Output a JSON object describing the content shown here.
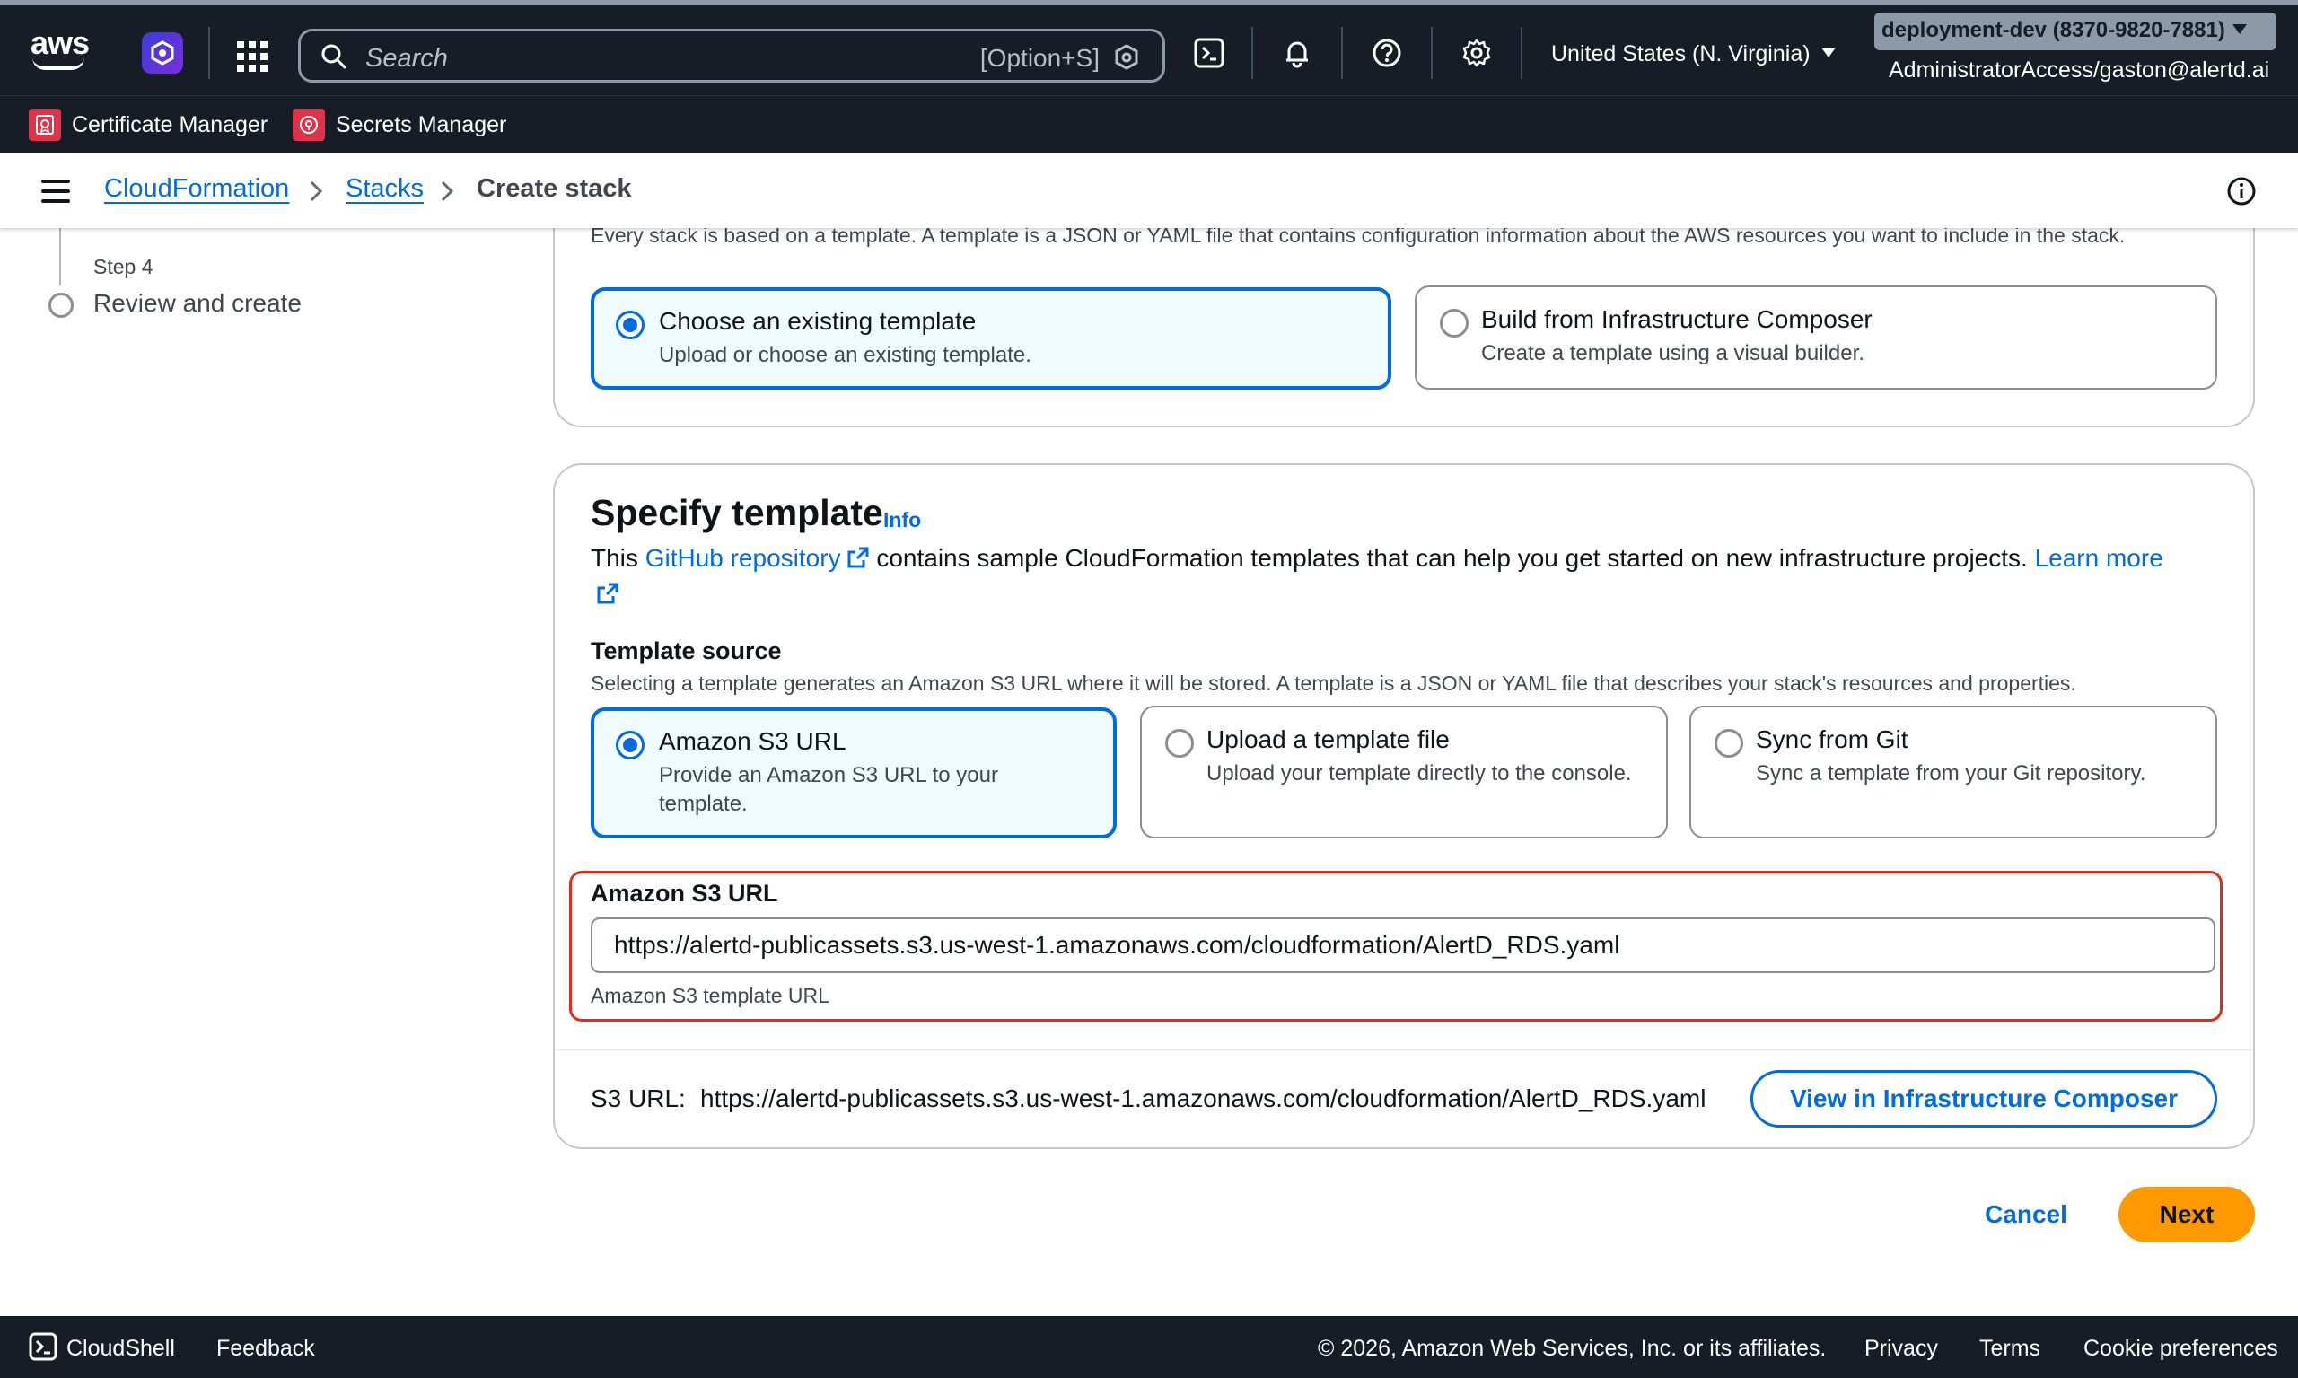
{
  "topnav": {
    "logo_text": "aws",
    "search_placeholder": "Search",
    "search_shortcut": "[Option+S]",
    "region": "United States (N. Virginia)",
    "account": "deployment-dev (8370-9820-7881)",
    "role": "AdministratorAccess/gaston@alertd.ai"
  },
  "favorites": [
    {
      "label": "Certificate Manager",
      "icon": "certificate-manager-icon"
    },
    {
      "label": "Secrets Manager",
      "icon": "secrets-manager-icon"
    }
  ],
  "breadcrumb": {
    "items": [
      "CloudFormation",
      "Stacks"
    ],
    "current": "Create stack"
  },
  "wizard": {
    "step_label": "Step 4",
    "step_title": "Review and create"
  },
  "prerequisite": {
    "description": "Every stack is based on a template. A template is a JSON or YAML file that contains configuration information about the AWS resources you want to include in the stack.",
    "options": [
      {
        "title": "Choose an existing template",
        "desc": "Upload or choose an existing template.",
        "selected": true
      },
      {
        "title": "Build from Infrastructure Composer",
        "desc": "Create a template using a visual builder.",
        "selected": false
      }
    ]
  },
  "specify": {
    "header": "Specify template",
    "info": "Info",
    "intro_pre": "This ",
    "intro_link": "GitHub repository",
    "intro_mid": " contains sample CloudFormation templates that can help you get started on new infrastructure projects. ",
    "learn_more": "Learn more",
    "source_label": "Template source",
    "source_desc": "Selecting a template generates an Amazon S3 URL where it will be stored. A template is a JSON or YAML file that describes your stack's resources and properties.",
    "sources": [
      {
        "title": "Amazon S3 URL",
        "desc": "Provide an Amazon S3 URL to your template.",
        "selected": true
      },
      {
        "title": "Upload a template file",
        "desc": "Upload your template directly to the console.",
        "selected": false
      },
      {
        "title": "Sync from Git",
        "desc": "Sync a template from your Git repository.",
        "selected": false
      }
    ],
    "url_label": "Amazon S3 URL",
    "url_value": "https://alertd-publicassets.s3.us-west-1.amazonaws.com/cloudformation/AlertD_RDS.yaml",
    "url_hint": "Amazon S3 template URL",
    "s3_label": "S3 URL:",
    "s3_value": "https://alertd-publicassets.s3.us-west-1.amazonaws.com/cloudformation/AlertD_RDS.yaml",
    "view_button": "View in Infrastructure Composer"
  },
  "actions": {
    "cancel": "Cancel",
    "next": "Next"
  },
  "footer": {
    "cloudshell": "CloudShell",
    "feedback": "Feedback",
    "copyright": "© 2026, Amazon Web Services, Inc. or its affiliates.",
    "privacy": "Privacy",
    "terms": "Terms",
    "cookies": "Cookie preferences"
  },
  "colors": {
    "accent": "#006ce0",
    "primary_button": "#ff9900",
    "highlight": "#e02d1b",
    "nav_bg": "#161d26"
  }
}
